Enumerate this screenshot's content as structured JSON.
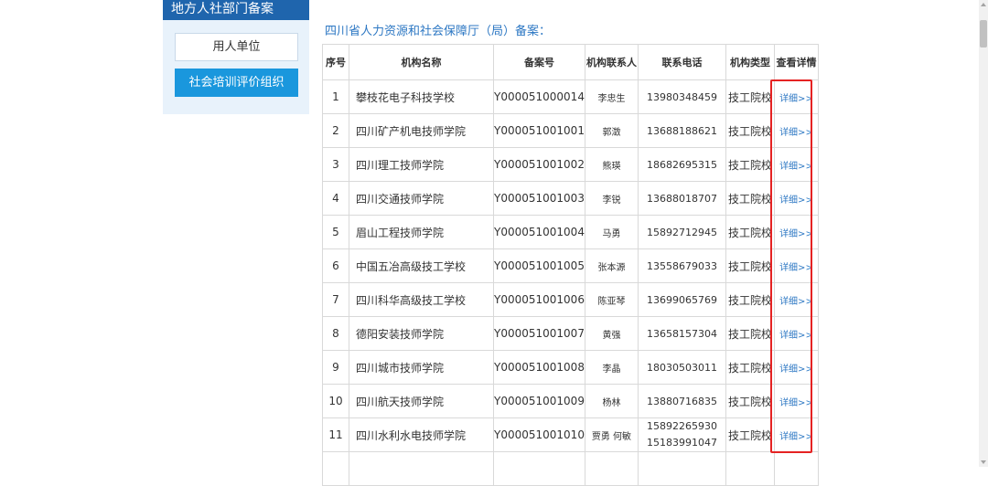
{
  "sidebar": {
    "title": "地方人社部门备案",
    "items": [
      {
        "label": "用人单位"
      },
      {
        "label": "社会培训评价组织"
      }
    ]
  },
  "heading": "四川省人力资源和社会保障厅（局）备案：",
  "table": {
    "headers": [
      "序号",
      "机构名称",
      "备案号",
      "机构联系人",
      "联系电话",
      "机构类型",
      "查看详情"
    ],
    "rows": [
      {
        "no": "1",
        "name": "攀枝花电子科技学校",
        "code": "Y000051000014",
        "contact": "李忠生",
        "phone": "13980348459",
        "phone2": "",
        "type": "技工院校",
        "detail": "详细>>"
      },
      {
        "no": "2",
        "name": "四川矿产机电技师学院",
        "code": "Y000051001001",
        "contact": "郭澂",
        "phone": "13688188621",
        "phone2": "",
        "type": "技工院校",
        "detail": "详细>>"
      },
      {
        "no": "3",
        "name": "四川理工技师学院",
        "code": "Y000051001002",
        "contact": "熊瑛",
        "phone": "18682695315",
        "phone2": "",
        "type": "技工院校",
        "detail": "详细>>"
      },
      {
        "no": "4",
        "name": "四川交通技师学院",
        "code": "Y000051001003",
        "contact": "李锐",
        "phone": "13688018707",
        "phone2": "",
        "type": "技工院校",
        "detail": "详细>>"
      },
      {
        "no": "5",
        "name": "眉山工程技师学院",
        "code": "Y000051001004",
        "contact": "马勇",
        "phone": "15892712945",
        "phone2": "",
        "type": "技工院校",
        "detail": "详细>>"
      },
      {
        "no": "6",
        "name": "中国五冶高级技工学校",
        "code": "Y000051001005",
        "contact": "张本源",
        "phone": "13558679033",
        "phone2": "",
        "type": "技工院校",
        "detail": "详细>>"
      },
      {
        "no": "7",
        "name": "四川科华高级技工学校",
        "code": "Y000051001006",
        "contact": "陈亚琴",
        "phone": "13699065769",
        "phone2": "",
        "type": "技工院校",
        "detail": "详细>>"
      },
      {
        "no": "8",
        "name": "德阳安装技师学院",
        "code": "Y000051001007",
        "contact": "黄强",
        "phone": "13658157304",
        "phone2": "",
        "type": "技工院校",
        "detail": "详细>>"
      },
      {
        "no": "9",
        "name": "四川城市技师学院",
        "code": "Y000051001008",
        "contact": "李晶",
        "phone": "18030503011",
        "phone2": "",
        "type": "技工院校",
        "detail": "详细>>"
      },
      {
        "no": "10",
        "name": "四川航天技师学院",
        "code": "Y000051001009",
        "contact": "杨林",
        "phone": "13880716835",
        "phone2": "",
        "type": "技工院校",
        "detail": "详细>>"
      },
      {
        "no": "11",
        "name": "四川水利水电技师学院",
        "code": "Y000051001010",
        "contact": "贾勇 何敏",
        "phone": "15892265930",
        "phone2": "15183991047",
        "type": "技工院校",
        "detail": "详细>>"
      }
    ]
  },
  "colors": {
    "sidebar_title_bg": "#1f65ad",
    "active_button_bg": "#1a97dd",
    "link": "#2c77c3",
    "highlight_border": "#e52222"
  }
}
